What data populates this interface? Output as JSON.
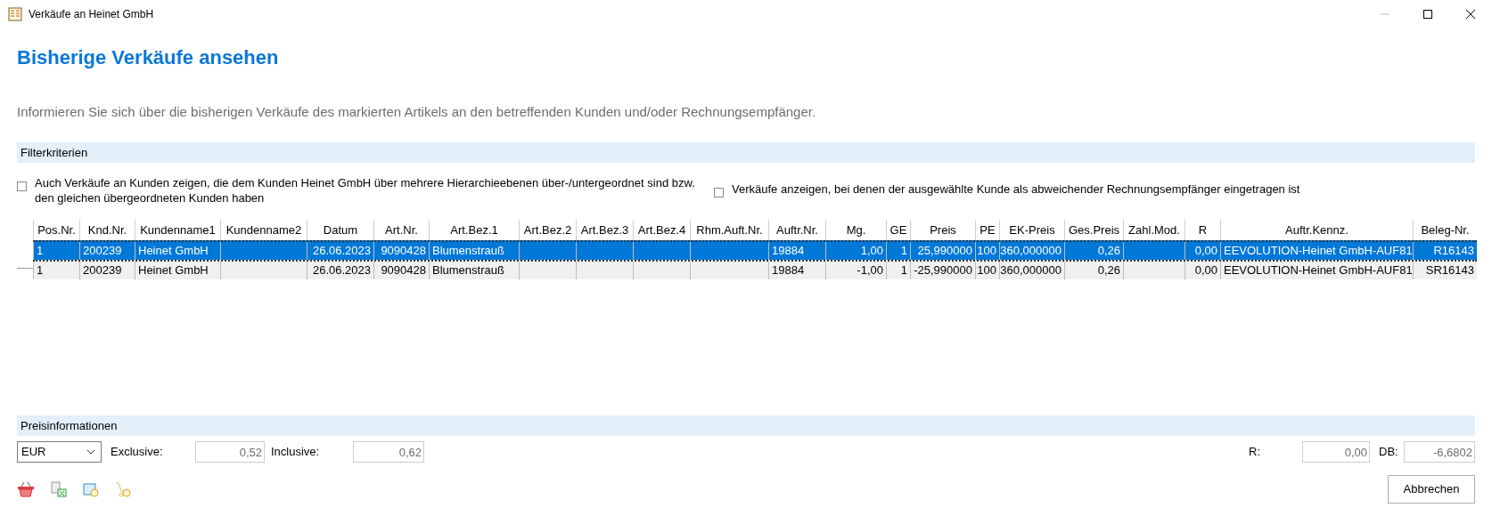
{
  "window": {
    "title": "Verkäufe an Heinet GmbH"
  },
  "heading": "Bisherige Verkäufe ansehen",
  "description": "Informieren Sie sich über die bisherigen Verkäufe des markierten Artikels an den betreffenden Kunden und/oder Rechnungsempfänger.",
  "filter": {
    "title": "Filterkriterien",
    "options": [
      {
        "label": "Auch Verkäufe an Kunden zeigen, die dem Kunden Heinet GmbH über mehrere Hierarchieebenen über-/untergeordnet sind bzw. den gleichen übergeordneten Kunden haben",
        "checked": false
      },
      {
        "label": "Verkäufe anzeigen, bei denen der ausgewählte Kunde als abweichender Rechnungsempfänger eingetragen ist",
        "checked": false
      }
    ]
  },
  "table": {
    "columns": [
      "Pos.Nr.",
      "Knd.Nr.",
      "Kundenname1",
      "Kundenname2",
      "Datum",
      "Art.Nr.",
      "Art.Bez.1",
      "Art.Bez.2",
      "Art.Bez.3",
      "Art.Bez.4",
      "Rhm.Auft.Nr.",
      "Auftr.Nr.",
      "Mg.",
      "GE",
      "Preis",
      "PE",
      "EK-Preis",
      "Ges.Preis",
      "Zahl.Mod.",
      "R",
      "Auftr.Kennz.",
      "Beleg-Nr."
    ],
    "rows": [
      {
        "selected": true,
        "cells": [
          "1",
          "200239",
          "Heinet GmbH",
          "",
          "26.06.2023",
          "9090428",
          "Blumenstrauß",
          "",
          "",
          "",
          "",
          "19884",
          "1,00",
          "1",
          "25,990000",
          "100",
          "360,000000",
          "0,26",
          "",
          "0,00",
          "EEVOLUTION-Heinet GmbH-AUF81",
          "R16143"
        ]
      },
      {
        "selected": false,
        "cells": [
          "1",
          "200239",
          "Heinet GmbH",
          "",
          "26.06.2023",
          "9090428",
          "Blumenstrauß",
          "",
          "",
          "",
          "",
          "19884",
          "-1,00",
          "1",
          "-25,990000",
          "100",
          "360,000000",
          "0,26",
          "",
          "0,00",
          "EEVOLUTION-Heinet GmbH-AUF81",
          "SR16143"
        ]
      }
    ]
  },
  "prices": {
    "title": "Preisinformationen",
    "currency": "EUR",
    "fields": [
      {
        "label": "Exclusive:",
        "value": "0,52"
      },
      {
        "label": "Inclusive:",
        "value": "0,62"
      },
      {
        "label": "R:",
        "value": "0,00"
      },
      {
        "label": "DB:",
        "value": "-6,6802"
      }
    ]
  },
  "cancel_button": "Abbrechen"
}
